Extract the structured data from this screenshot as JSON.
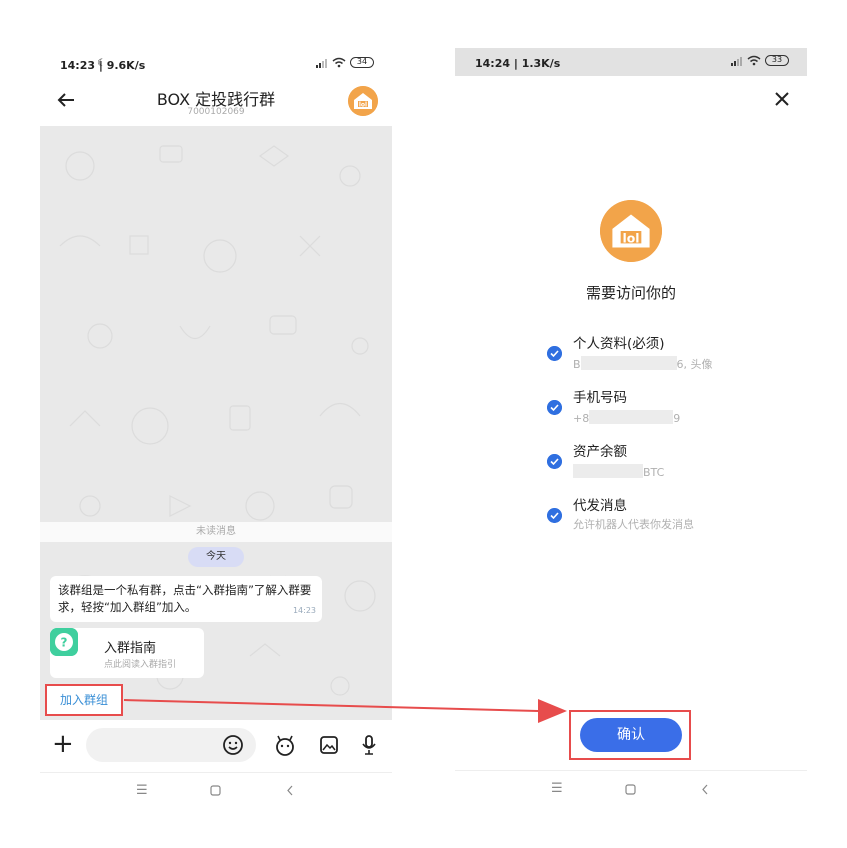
{
  "left": {
    "status": {
      "time": "14:23 | 9.6K/s",
      "battery": "34"
    },
    "header": {
      "title": "BOX 定投践行群",
      "subtitle": "7000102069"
    },
    "chat": {
      "unread_label": "未读消息",
      "date_pill": "今天",
      "message": "该群组是一个私有群，点击“入群指南”了解入群要求，轻按“加入群组”加入。",
      "message_time": "14:23",
      "guide_card": {
        "title": "入群指南",
        "subtitle": "点此阅读入群指引"
      },
      "join_button": "加入群组"
    },
    "input_bar": {
      "plus": "+"
    }
  },
  "right": {
    "status": {
      "time": "14:24 | 1.3K/s",
      "battery": "33"
    },
    "permission_title": "需要访问你的",
    "permissions": [
      {
        "label": "个人资料(必须)",
        "detail_prefix": "B",
        "detail_suffix": "6, 头像"
      },
      {
        "label": "手机号码",
        "detail_prefix": "+8",
        "detail_suffix": "9"
      },
      {
        "label": "资产余额",
        "detail_prefix": "",
        "detail_suffix": "BTC"
      },
      {
        "label": "代发消息",
        "detail_prefix": "允许机器人代表你发消息",
        "detail_suffix": ""
      }
    ],
    "confirm_button": "确认"
  },
  "colors": {
    "accent_blue": "#3a6ee8",
    "highlight_red": "#e74c4c",
    "app_orange": "#f2a44a",
    "guide_green": "#3fcf9e"
  },
  "icons": [
    "back-arrow-icon",
    "app-house-icon",
    "emoji-icon",
    "bot-icon",
    "image-icon",
    "mic-icon",
    "close-icon",
    "check-icon",
    "menu-icon",
    "home-icon",
    "back-nav-icon",
    "wifi-icon",
    "signal-icon",
    "moon-icon"
  ]
}
